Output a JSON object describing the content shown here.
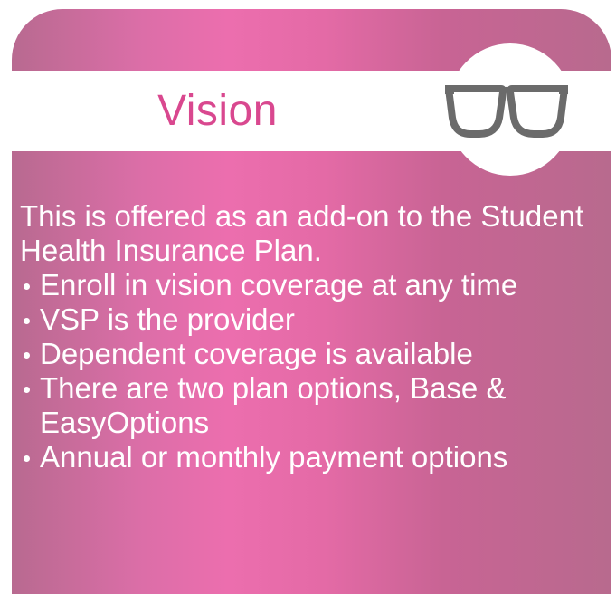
{
  "card": {
    "title": "Vision",
    "icon": "eyeglasses-icon",
    "intro": "This is offered as an add-on to the Student Health Insurance Plan.",
    "bullets": [
      "Enroll in vision coverage at any time",
      "VSP is the provider",
      "Dependent coverage is available",
      "There are two plan options, Base & EasyOptions",
      "Annual or monthly payment options"
    ]
  },
  "colors": {
    "accent": "#d9488f",
    "card_background": "#e46aa6",
    "glasses": "#6b6b6b"
  }
}
